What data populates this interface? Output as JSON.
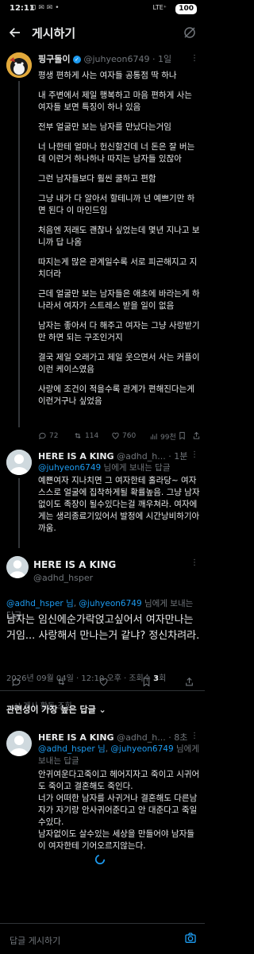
{
  "status_bar": {
    "time": "12:11",
    "icons": "⊡ ✉ ✉ •",
    "network": "LTE⁺",
    "battery": "100"
  },
  "header": {
    "title": "게시하기"
  },
  "post": {
    "author_name": "핑구돌이",
    "handle": "@juhyeon6749",
    "time": "· 1일",
    "paragraphs": [
      "평생 편하게 사는 여자들 공통점 딱 하나",
      "내 주변에서 제일 행복하고 마음 편하게 사는 여자들 보면 특징이 하나 있음",
      "전부 얼굴만 보는 남자를 만났다는거임",
      "너 나한테 얼마나 헌신할건데 너 돈은 잘 버는데 이런거 하나하나 따지는 남자들 있잖아",
      "그런 남자들보다 훨씬 쿨하고 편함",
      "그냥 내가 다 알아서 할테니까 넌 예쁘기만 하면 된다 이 마인드임",
      "처음엔 저래도 괜찮나 싶었는데 몇년 지나고 보니까 답 나옴",
      "따지는게 많은 관계일수록 서로 피곤해지고 지치더라",
      "근데 얼굴만 보는 남자들은 애초에 바라는게 하나라서 여자가 스트레스 받을 일이 없음",
      "남자는 좋아서 다 해주고 여자는 그냥 사랑받기만 하면 되는 구조인거지",
      "결국 제일 오래가고 제일 웃으면서 사는 커플이 이런 케이스였음",
      "사랑에 조건이 적을수록 관계가 편해진다는게 이런거구나 싶었음"
    ],
    "actions": {
      "replies": "72",
      "retweets": "114",
      "likes": "760",
      "views": "99천"
    }
  },
  "reply1": {
    "author_name": "HERE IS A KING",
    "handle": "@adhd_h...",
    "time": "· 1분",
    "replying_prefix": "",
    "replying_to": "@juhyeon6749",
    "replying_suffix": " 님에게 보내는 답글",
    "body": "예쁜여자 지나치면 그 여자한테 홀라당~ 여자 스스로 얼굴에 집착하게될 확률높음. 그냥 남자없이도 족장이 될수있다는걸 깨우쳐라. 여자에게는 생리종료기있어서 발정에 시간낭비하기아까움."
  },
  "main_post": {
    "author_name": "HERE IS A KING",
    "handle": "@adhd_hsper",
    "replying_to_1": "@adhd_hsper 님",
    "replying_sep": ", ",
    "replying_to_2": "@juhyeon6749",
    "replying_suffix": " 님에게 보내는 답글",
    "body": "남자는 임신에순가락얹고싶어서 여자만나는거임... 사랑해서 만나는거 같냐? 정신차려라.",
    "timestamp": "2026년 09월 04일 · 12:10 오후 · 조회수 ",
    "views": "3",
    "views_suffix": "회",
    "activity": "게시 활동 조회"
  },
  "sort_label": "관련성이 가장 높은 답글 ⌄",
  "reply2": {
    "author_name": "HERE IS A KING",
    "handle": "@adhd_h...",
    "time": "· 8초",
    "replying_to_1": "@adhd_hsper 님",
    "replying_sep": ", ",
    "replying_to_2": "@juhyeon6749",
    "replying_suffix": " 님에게 보내는 답글",
    "body_lines": [
      "안귀여운다고죽이고 헤어지자고 죽이고 시귀어도 죽이고 결혼해도 죽인다.",
      "너가 어떠한 남자를 사귀거나 결혼해도 다른남자가 자기랑 안사귀어준다고 안 대준다고 죽일수있다.",
      "남자없이도 살수있는 세상을 만들어야 남자들이 여자한테 기어오르지않는다."
    ]
  },
  "composer": {
    "placeholder": "답글 게시하기"
  },
  "colors": {
    "accent": "#1d9bf0",
    "background": "#000000",
    "muted": "#71767b"
  }
}
